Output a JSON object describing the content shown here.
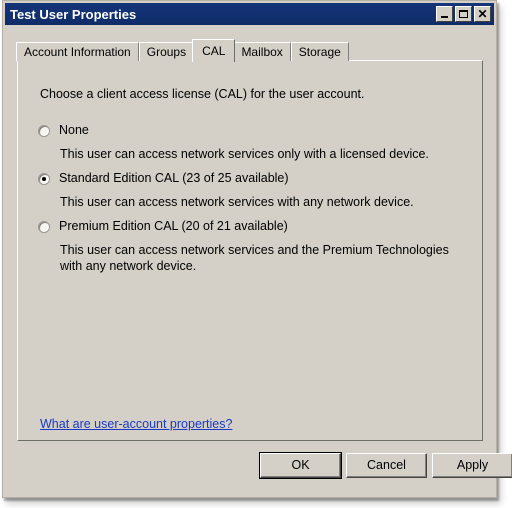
{
  "window": {
    "title": "Test User Properties",
    "controls": [
      {
        "name": "minimize-button",
        "icon": "minimize-icon",
        "label": "_"
      },
      {
        "name": "maximize-button",
        "icon": "maximize-icon",
        "label": "□"
      },
      {
        "name": "close-button",
        "icon": "close-icon",
        "label": "✕"
      }
    ],
    "titlebar_color": "#12306e",
    "face_color": "#d4d0c8"
  },
  "tabs": [
    {
      "label": "Account Information",
      "selected": false
    },
    {
      "label": "Groups",
      "selected": false
    },
    {
      "label": "CAL",
      "selected": true
    },
    {
      "label": "Mailbox",
      "selected": false
    },
    {
      "label": "Storage",
      "selected": false
    }
  ],
  "page": {
    "intro": "Choose a client access license (CAL) for the user account.",
    "options": [
      {
        "id": "none",
        "label": "None",
        "checked": false,
        "description": "This user can access network services only with a licensed device."
      },
      {
        "id": "standard",
        "label": "Standard Edition CAL (23 of 25 available)",
        "checked": true,
        "description": "This user can access network services with any network device."
      },
      {
        "id": "premium",
        "label": "Premium Edition CAL (20 of 21 available)",
        "checked": false,
        "description": "This user can access network services and the Premium Technologies with any network device."
      }
    ],
    "help_link": {
      "text": "What are user-account properties?",
      "color": "#1a39c4"
    }
  },
  "buttons": {
    "ok": "OK",
    "cancel": "Cancel",
    "apply": "Apply"
  }
}
